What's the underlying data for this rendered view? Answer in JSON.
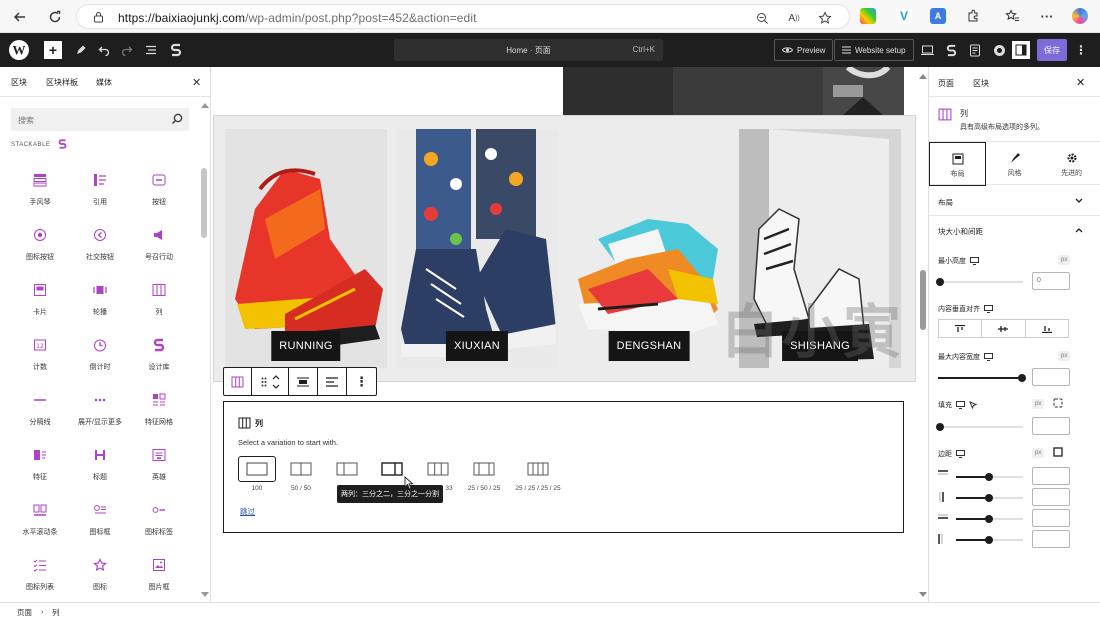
{
  "browser": {
    "url_host": "https://baixiaojunkj.com",
    "url_path": "/wp-admin/post.php?post=452&action=edit"
  },
  "wp_toolbar": {
    "command_center": "Home · 页面",
    "shortcut": "Ctrl+K",
    "preview_label": "Preview",
    "website_setup_label": "Website setup",
    "save_label": "保存"
  },
  "inserter": {
    "tabs": [
      "区块",
      "区块样板",
      "媒体"
    ],
    "search_placeholder": "搜索",
    "section_label": "STACKABLE",
    "blocks": [
      {
        "label": "手风琴",
        "icon": "accordion-icon"
      },
      {
        "label": "引用",
        "icon": "quote-icon"
      },
      {
        "label": "按钮",
        "icon": "button-icon"
      },
      {
        "label": "图标按钮",
        "icon": "icon-button-icon"
      },
      {
        "label": "社交按钮",
        "icon": "social-buttons-icon"
      },
      {
        "label": "号召行动",
        "icon": "call-to-action-icon"
      },
      {
        "label": "卡片",
        "icon": "card-icon"
      },
      {
        "label": "轮播",
        "icon": "carousel-icon"
      },
      {
        "label": "列",
        "icon": "columns-icon"
      },
      {
        "label": "计数",
        "icon": "count-up-icon"
      },
      {
        "label": "倒计时",
        "icon": "countdown-icon"
      },
      {
        "label": "设计库",
        "icon": "design-library-icon"
      },
      {
        "label": "分隔线",
        "icon": "divider-icon"
      },
      {
        "label": "展开/显示更多",
        "icon": "expand-icon"
      },
      {
        "label": "特征网格",
        "icon": "feature-grid-icon"
      },
      {
        "label": "特征",
        "icon": "feature-icon"
      },
      {
        "label": "标题",
        "icon": "heading-icon"
      },
      {
        "label": "英雄",
        "icon": "hero-icon"
      },
      {
        "label": "水平滚动条",
        "icon": "horizontal-scroller-icon"
      },
      {
        "label": "图标框",
        "icon": "icon-box-icon"
      },
      {
        "label": "图标标签",
        "icon": "icon-label-icon"
      },
      {
        "label": "图标列表",
        "icon": "icon-list-icon"
      },
      {
        "label": "图标",
        "icon": "star-icon"
      },
      {
        "label": "图片框",
        "icon": "image-box-icon"
      }
    ]
  },
  "canvas": {
    "photos": [
      {
        "label": "RUNNING"
      },
      {
        "label": "XIUXIAN"
      },
      {
        "label": "DENGSHAN"
      },
      {
        "label": "SHISHANG"
      }
    ],
    "watermark": "白小寅",
    "placeholder": {
      "title": "列",
      "subtitle": "Select a variation to start with.",
      "variations": [
        "100",
        "50 / 50",
        "",
        "",
        "33",
        "25 / 50 / 25",
        "25 / 25 / 25 / 25"
      ],
      "tooltip": "两列：三分之二，三分之一分割",
      "skip_label": "跳过"
    }
  },
  "inspector": {
    "tabs": [
      "页面",
      "区块"
    ],
    "block_name": "列",
    "block_desc": "具有高级布局选项的多列。",
    "style_tabs": [
      "布局",
      "风格",
      "先进的"
    ],
    "sections": {
      "layout": "布局",
      "spacing": "块大小和间距"
    },
    "fields": {
      "min_height": "最小高度",
      "min_height_value": "0",
      "content_valign": "内容垂直对齐",
      "max_width": "最大内容宽度",
      "padding": "填充",
      "margin": "边距",
      "unit": "px"
    }
  },
  "statusbar": {
    "crumb1": "页面",
    "sep": "›",
    "crumb2": "列"
  }
}
